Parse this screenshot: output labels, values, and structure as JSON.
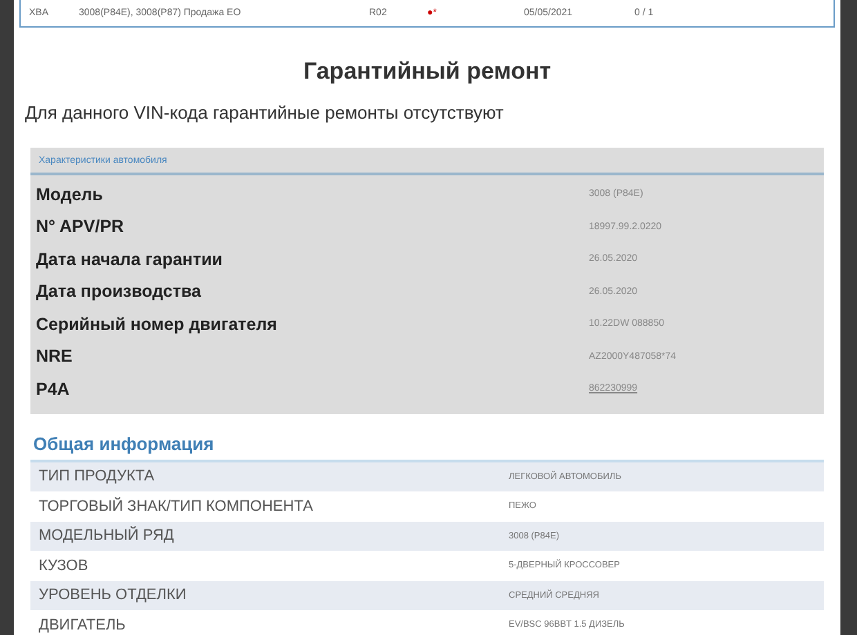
{
  "top_row": [
    "XBA",
    "3008(P84E), 3008(P87) Продажа ЕО",
    "R02",
    "●*",
    "05/05/2021",
    "0 / 1"
  ],
  "title": "Гарантийный ремонт",
  "notice": "Для данного VIN-кода гарантийные ремонты отсутствуют",
  "vehicle": {
    "header": "Характеристики автомобиля",
    "rows": [
      {
        "label": "Модель",
        "value": "3008 (P84E)",
        "underlined": false
      },
      {
        "label": "N° APV/PR",
        "value": "18997.99.2.0220",
        "underlined": false
      },
      {
        "label": "Дата начала гарантии",
        "value": "26.05.2020",
        "underlined": false
      },
      {
        "label": "Дата производства",
        "value": "26.05.2020",
        "underlined": false
      },
      {
        "label": "Серийный номер двигателя",
        "value": "10.22DW 088850",
        "underlined": false
      },
      {
        "label": "NRE",
        "value": "AZ2000Y487058*74",
        "underlined": false
      },
      {
        "label": "P4A",
        "value": "862230999",
        "underlined": true
      }
    ]
  },
  "general": {
    "heading": "Общая информация",
    "rows": [
      {
        "label": "ТИП ПРОДУКТА",
        "value": "ЛЕГКОВОЙ АВТОМОБИЛЬ"
      },
      {
        "label": "ТОРГОВЫЙ ЗНАК/ТИП КОМПОНЕНТА",
        "value": "ПЕЖО"
      },
      {
        "label": "МОДЕЛЬНЫЙ РЯД",
        "value": "3008 (P84E)"
      },
      {
        "label": "КУЗОВ",
        "value": "5-ДВЕРНЫЙ КРОССОВЕР"
      },
      {
        "label": "УРОВЕНЬ ОТДЕЛКИ",
        "value": "СРЕДНИЙ СРЕДНЯЯ"
      },
      {
        "label": "ДВИГАТЕЛЬ",
        "value": "EV/BSC 96BBT 1.5 ДИЗЕЛЬ"
      }
    ]
  }
}
